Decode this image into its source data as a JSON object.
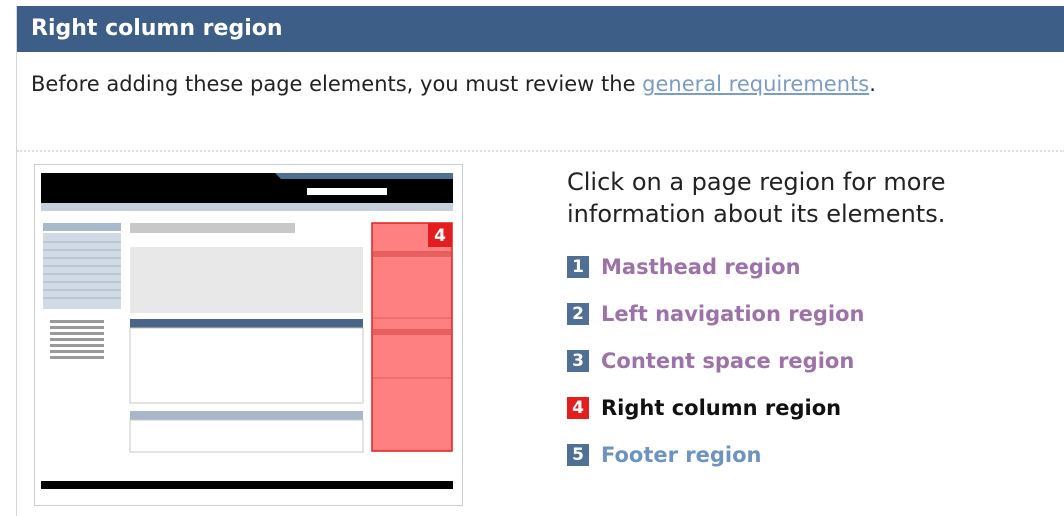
{
  "header": {
    "title": "Right column region"
  },
  "intro": {
    "before": "Before adding these page elements, you must review the ",
    "link": "general requirements",
    "after": "."
  },
  "hint": "Click on a page region for more information about its elements.",
  "regions": [
    {
      "number": "1",
      "label": "Masthead region",
      "active": false
    },
    {
      "number": "2",
      "label": "Left navigation region",
      "active": false
    },
    {
      "number": "3",
      "label": "Content space region",
      "active": false
    },
    {
      "number": "4",
      "label": "Right column region",
      "active": true
    },
    {
      "number": "5",
      "label": "Footer region",
      "active": false
    }
  ],
  "thumbnail": {
    "highlight_number": "4"
  },
  "colors": {
    "header_bg": "#3d5f87",
    "visited_link": "#9d72a8",
    "link": "#6d93c1",
    "active_badge": "#e41e1e",
    "badge": "#4f6f95"
  }
}
